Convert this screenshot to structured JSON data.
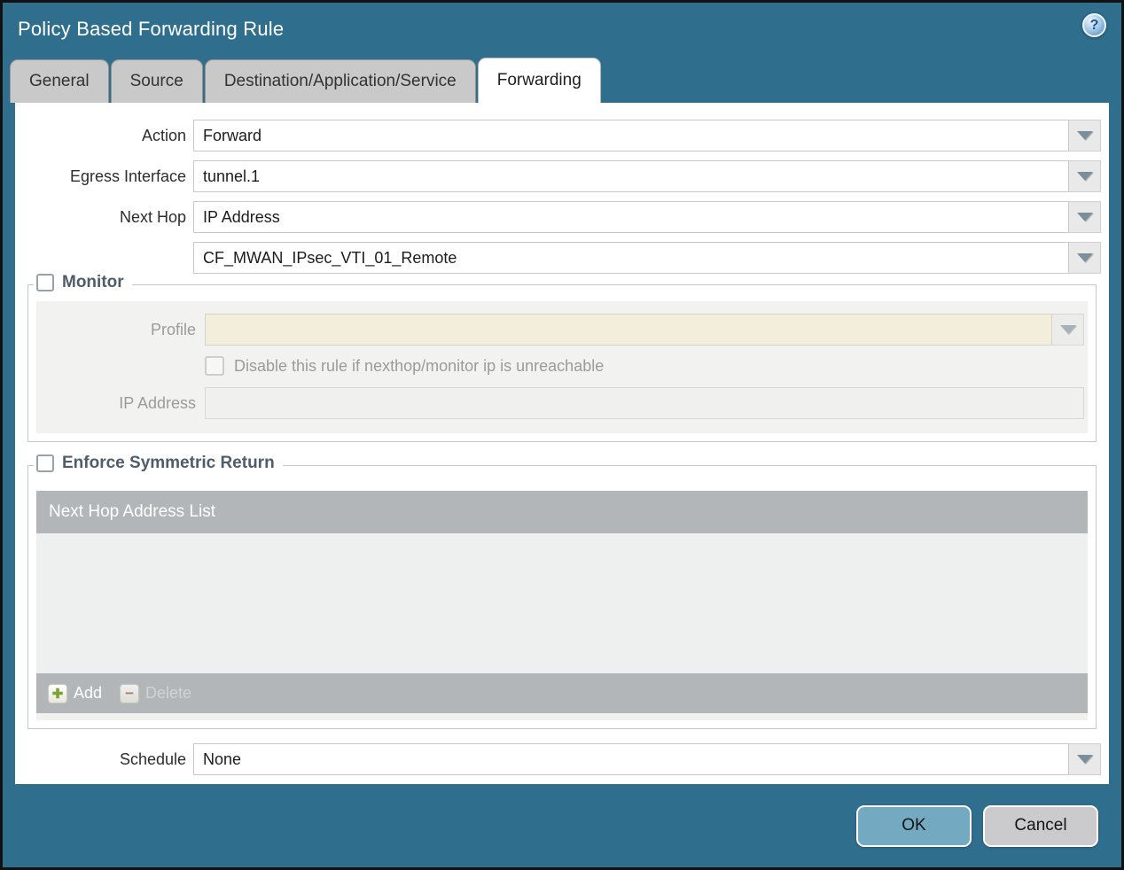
{
  "dialog": {
    "title": "Policy Based Forwarding Rule"
  },
  "tabs": [
    {
      "label": "General",
      "active": false
    },
    {
      "label": "Source",
      "active": false
    },
    {
      "label": "Destination/Application/Service",
      "active": false
    },
    {
      "label": "Forwarding",
      "active": true
    }
  ],
  "form": {
    "action": {
      "label": "Action",
      "value": "Forward"
    },
    "egress_interface": {
      "label": "Egress Interface",
      "value": "tunnel.1"
    },
    "next_hop": {
      "label": "Next Hop",
      "value": "IP Address"
    },
    "next_hop_address": {
      "value": "CF_MWAN_IPsec_VTI_01_Remote"
    },
    "schedule": {
      "label": "Schedule",
      "value": "None"
    }
  },
  "monitor": {
    "legend": "Monitor",
    "checked": false,
    "profile": {
      "label": "Profile",
      "value": ""
    },
    "disable_rule_checkbox": {
      "label": "Disable this rule if nexthop/monitor ip is unreachable",
      "checked": false
    },
    "ip_address": {
      "label": "IP Address",
      "value": ""
    }
  },
  "enforce_symmetric_return": {
    "legend": "Enforce Symmetric Return",
    "checked": false,
    "table": {
      "header": "Next Hop Address List",
      "rows": []
    },
    "toolbar": {
      "add_label": "Add",
      "delete_label": "Delete",
      "delete_enabled": false
    }
  },
  "footer": {
    "ok_label": "OK",
    "cancel_label": "Cancel"
  },
  "icons": {
    "help": "?",
    "add": "✚",
    "delete": "−",
    "dropdown": "▼"
  },
  "colors": {
    "titlebar_teal": "#2f6e8d",
    "tab_inactive": "#c9c9c9",
    "legend_slate": "#4e5c6b",
    "disabled_field_cream": "#f3eddb",
    "panel_gray": "#f2f2f0",
    "table_bar_gray": "#b2b6b9",
    "ok_button": "#73a9c1",
    "cancel_button": "#cbcbce",
    "add_icon_green": "#7ca32f",
    "delete_icon_red": "#b06a52"
  }
}
